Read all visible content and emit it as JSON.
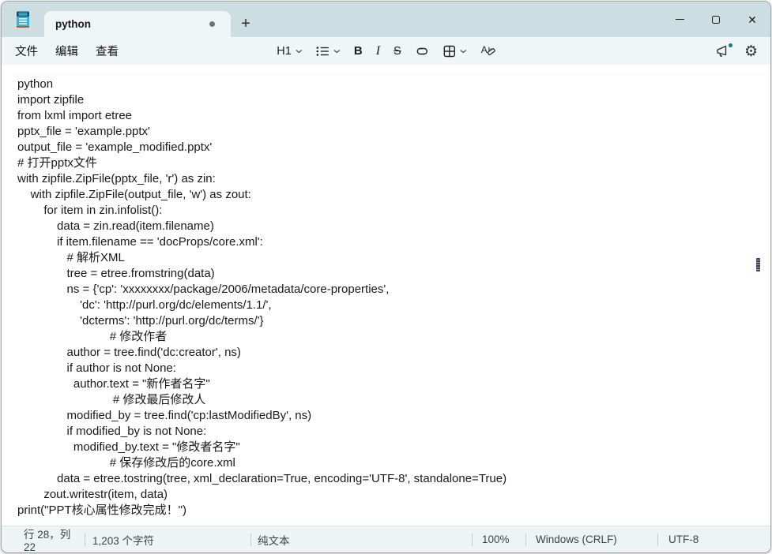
{
  "titlebar": {
    "tab_title": "python",
    "new_tab_label": "+"
  },
  "menubar": {
    "items": [
      "文件",
      "编辑",
      "查看"
    ]
  },
  "toolbar": {
    "heading_label": "H1",
    "bold_label": "B",
    "italic_label": "I",
    "strikethrough_label": "S",
    "icons": {
      "app": "notepad-icon",
      "list": "bullet-list-icon",
      "link": "link-icon",
      "table": "table-icon",
      "clear_format": "clear-formatting-icon",
      "announce": "megaphone-icon",
      "settings": "gear-icon"
    }
  },
  "editor": {
    "code_lines": [
      "python",
      "import zipfile",
      "from lxml import etree",
      "pptx_file = 'example.pptx'",
      "output_file = 'example_modified.pptx'",
      "# 打开pptx文件",
      "with zipfile.ZipFile(pptx_file, 'r') as zin:",
      "    with zipfile.ZipFile(output_file, 'w') as zout:",
      "        for item in zin.infolist():",
      "            data = zin.read(item.filename)",
      "            if item.filename == 'docProps/core.xml':",
      "               # 解析XML",
      "               tree = etree.fromstring(data)",
      "               ns = {'cp': 'xxxxxxxx/package/2006/metadata/core-properties',",
      "                   'dc': 'http://purl.org/dc/elements/1.1/',",
      "                   'dcterms': 'http://purl.org/dc/terms/'}",
      "                            # 修改作者",
      "               author = tree.find('dc:creator', ns)",
      "               if author is not None:",
      "                 author.text = \"新作者名字\"",
      "                             # 修改最后修改人",
      "               modified_by = tree.find('cp:lastModifiedBy', ns)",
      "               if modified_by is not None:",
      "                 modified_by.text = \"修改者名字\"",
      "                            # 保存修改后的core.xml",
      "            data = etree.tostring(tree, xml_declaration=True, encoding='UTF-8', standalone=True)",
      "        zout.writestr(item, data)",
      "print(\"PPT核心属性修改完成！\")"
    ]
  },
  "statusbar": {
    "cursor_position": "行 28，列 22",
    "char_count": "1,203 个字符",
    "doc_type": "纯文本",
    "zoom_level": "100%",
    "line_ending": "Windows (CRLF)",
    "encoding": "UTF-8"
  },
  "colors": {
    "titlebar_bg": "#cddee3",
    "chrome_bg": "#f0f6f7",
    "statusbar_bg": "#eef3f3",
    "accent_dot": "#0e7c8c",
    "text": "#191919"
  }
}
